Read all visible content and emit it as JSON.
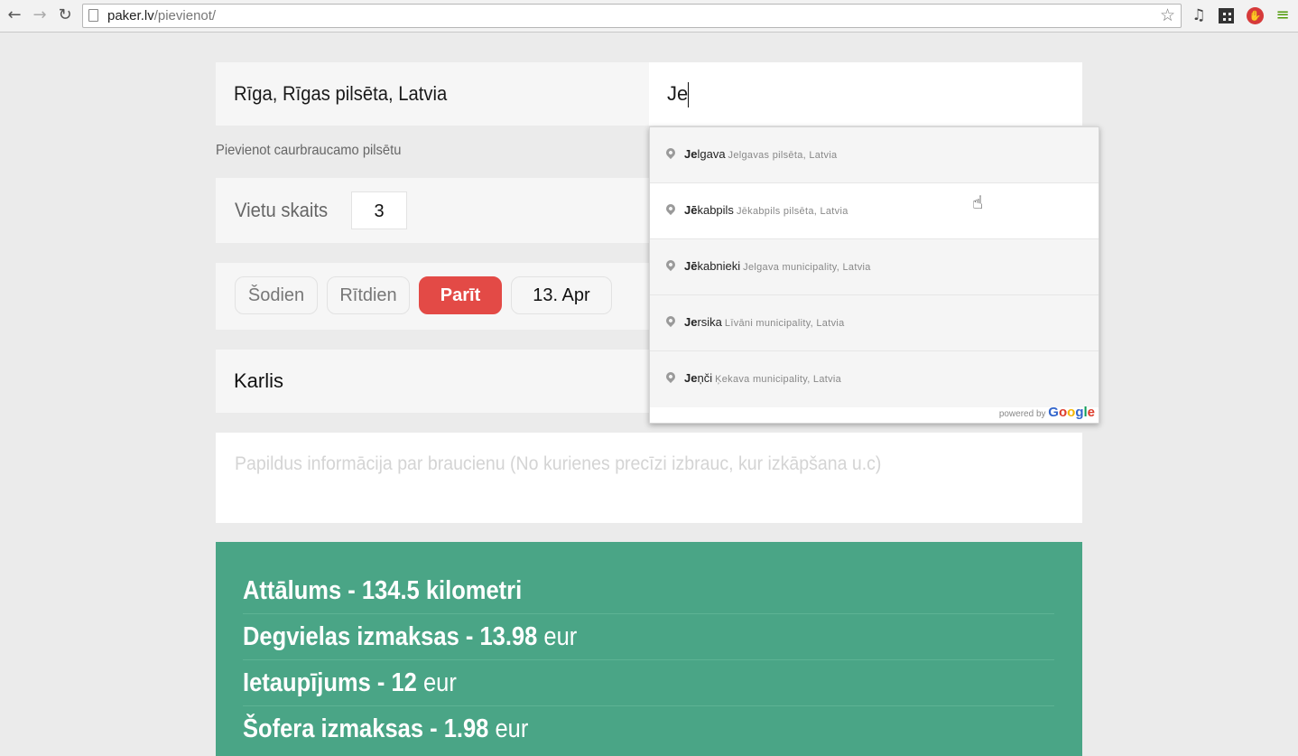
{
  "browser": {
    "url_host": "paker.lv",
    "url_path": "/pievienot/",
    "back_icon": "arrow-left-icon",
    "forward_icon": "arrow-right-icon",
    "reload_icon": "reload-icon",
    "bookmark_icon": "star-icon",
    "extensions": [
      "music-note-icon",
      "qr-code-icon",
      "stop-icon",
      "menu-icon"
    ]
  },
  "route": {
    "from_value": "Rīga, Rīgas pilsēta, Latvia",
    "to_value": "Je",
    "add_city_link": "Pievienot caurbraucamo pilsētu"
  },
  "seats": {
    "label": "Vietu skaits",
    "count": "3"
  },
  "dates": {
    "today": "Šodien",
    "tomorrow": "Rītdien",
    "day_after": "Parīt",
    "date": "13. Apr",
    "selected": "Parīt"
  },
  "driver": {
    "name": "Karlis"
  },
  "info": {
    "placeholder": "Papildus informācija par braucienu (No kurienes precīzi izbrauc, kur izkāpšana u.c)"
  },
  "stats": {
    "distance_label": "Attālums - ",
    "distance_value": "134.5",
    "distance_unit": " kilometri",
    "fuel_label": "Degvielas izmaksas - ",
    "fuel_value": "13.98",
    "fuel_unit": " eur",
    "savings_label": "Ietaupījums - ",
    "savings_value": "12",
    "savings_unit": " eur",
    "driver_label": "Šofera izmaksas - ",
    "driver_value": "1.98",
    "driver_unit": " eur"
  },
  "autocomplete": {
    "items": [
      {
        "match": "Je",
        "rest": "lgava",
        "secondary": "Jelgavas pilsēta, Latvia"
      },
      {
        "match": "Jē",
        "rest": "kabpils",
        "secondary": "Jēkabpils pilsēta, Latvia"
      },
      {
        "match": "Jē",
        "rest": "kabnieki",
        "secondary": "Jelgava municipality, Latvia"
      },
      {
        "match": "Je",
        "rest": "rsika",
        "secondary": "Līvāni municipality, Latvia"
      },
      {
        "match": "Je",
        "rest": "ņči",
        "secondary": "Ķekava municipality, Latvia"
      }
    ],
    "powered_by": "powered by",
    "brand": "Google"
  }
}
